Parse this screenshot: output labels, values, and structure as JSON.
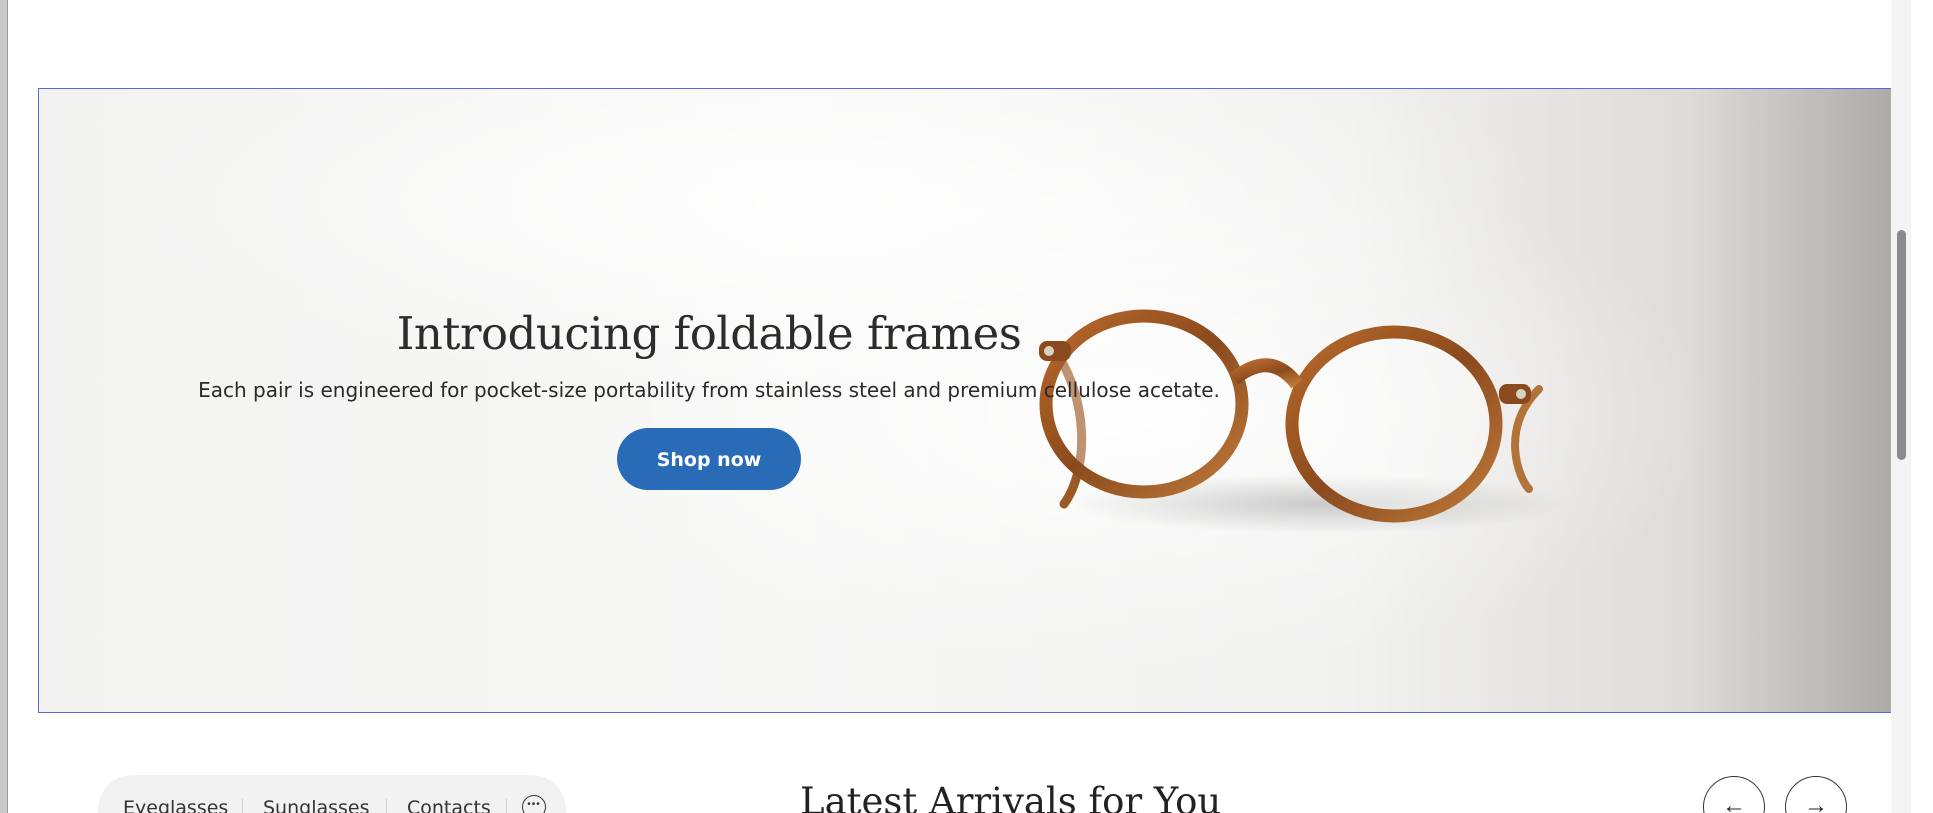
{
  "hero": {
    "title": "Introducing foldable frames",
    "subtitle": "Each pair is engineered for pocket-size portability from stainless steel and premium cellulose acetate.",
    "cta_label": "Shop now",
    "cta_color": "#2a6bb7"
  },
  "category_nav": {
    "items": [
      "Eyeglasses",
      "Sunglasses",
      "Contacts"
    ],
    "more_icon": "more-dots-icon"
  },
  "arrivals": {
    "title": "Latest Arrivals for You",
    "prev_icon": "arrow-left-icon",
    "next_icon": "arrow-right-icon",
    "prev_glyph": "←",
    "next_glyph": "→"
  },
  "colors": {
    "selection_outline": "#4f6fd6",
    "frame_tortoise": "#a8632a"
  }
}
